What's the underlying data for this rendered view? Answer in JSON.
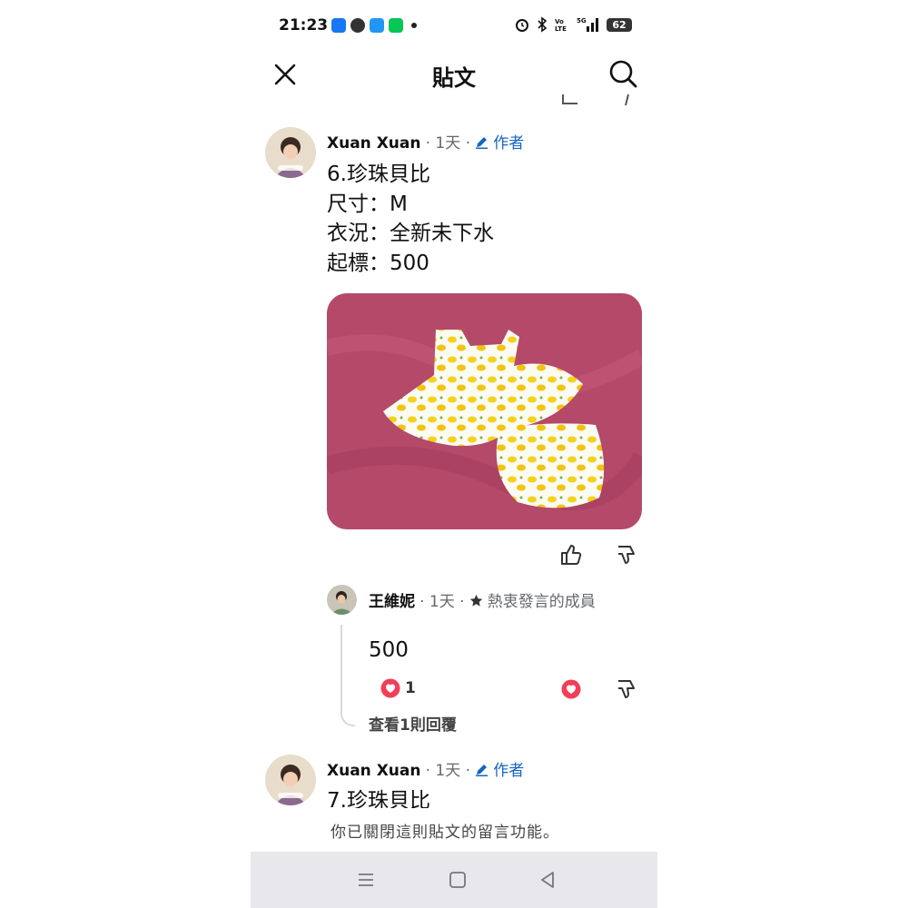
{
  "status_bar": {
    "time": "21:23",
    "battery": "62",
    "notification_icons": [
      "facebook-icon",
      "messenger-icon",
      "app-icon",
      "line-icon"
    ],
    "system_icons": [
      "alarm-icon",
      "bluetooth-icon",
      "volte-icon",
      "5g-signal-icon",
      "battery-icon"
    ]
  },
  "header": {
    "title": "貼文"
  },
  "post_1": {
    "author": "Xuan Xuan",
    "time": "· 1天 ·",
    "role": "作者",
    "text": "6.珍珠貝比\n尺寸：M\n衣況：全新未下水\n起標：500"
  },
  "reply_1": {
    "author": "王維妮",
    "time": "· 1天 ·",
    "badge": "熱衷發言的成員",
    "text": "500",
    "reaction_count": "1",
    "view_replies": "查看1則回覆"
  },
  "post_2": {
    "author": "Xuan Xuan",
    "time": "· 1天 ·",
    "role": "作者",
    "text": "7.珍珠貝比"
  },
  "footer": {
    "closed_note": "你已關閉這則貼文的留言功能。"
  },
  "colors": {
    "accent": "#1565c0",
    "love_reaction": "#f33e58",
    "nav_bar": "#e8e8ec"
  }
}
